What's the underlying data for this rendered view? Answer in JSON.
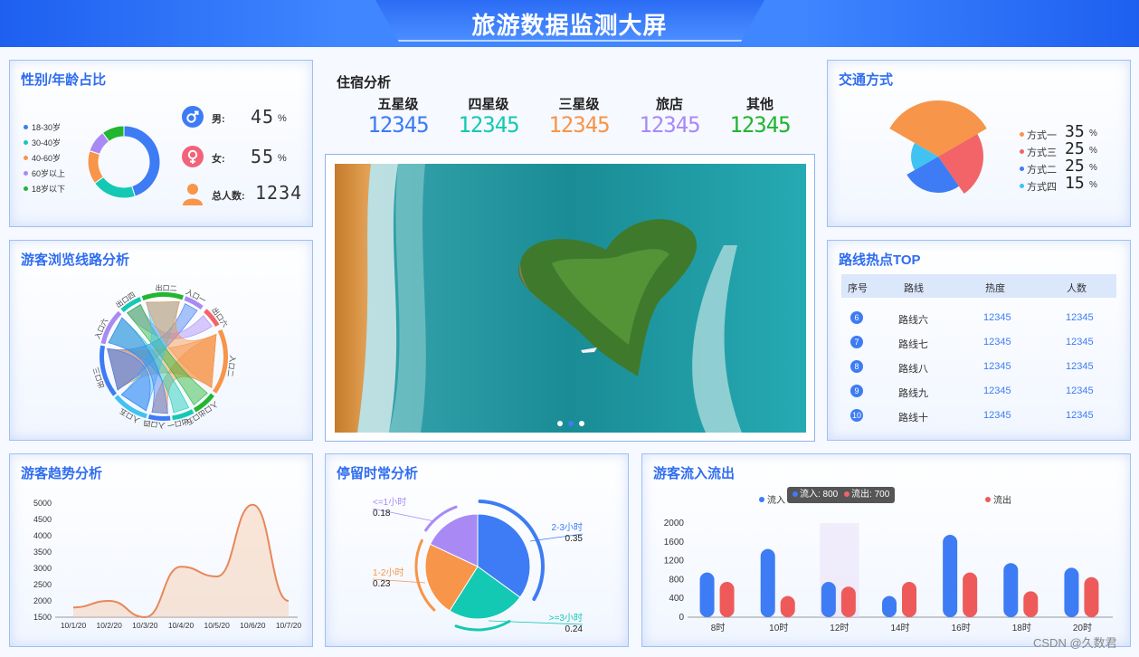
{
  "header": {
    "title": "旅游数据监测大屏"
  },
  "colors": {
    "blue": "#3d7cf4",
    "teal": "#14c9b4",
    "orange": "#f7954a",
    "purple": "#a98af5",
    "green": "#22b531",
    "red": "#f26467",
    "pink": "#f2627a",
    "cyan": "#40c2f2"
  },
  "gender": {
    "title": "性别/年龄占比",
    "legend": [
      "18-30岁",
      "30-40岁",
      "40-60岁",
      "60岁以上",
      "18岁以下"
    ],
    "male_label": "男:",
    "male_value": "45",
    "female_label": "女:",
    "female_value": "55",
    "percent": "%",
    "total_label": "总人数:",
    "total_value": "1234"
  },
  "lodging": {
    "title": "住宿分析",
    "items": [
      {
        "label": "五星级",
        "value": "12345"
      },
      {
        "label": "四星级",
        "value": "12345"
      },
      {
        "label": "三星级",
        "value": "12345"
      },
      {
        "label": "旅店",
        "value": "12345"
      },
      {
        "label": "其他",
        "value": "12345"
      }
    ]
  },
  "traffic": {
    "title": "交通方式",
    "items": [
      {
        "label": "方式一",
        "value": "35"
      },
      {
        "label": "方式三",
        "value": "25"
      },
      {
        "label": "方式二",
        "value": "25"
      },
      {
        "label": "方式四",
        "value": "15"
      }
    ],
    "percent": "%"
  },
  "route": {
    "title": "游客浏览线路分析",
    "nodes": [
      "入口一",
      "出口六",
      "入口二",
      "入口出口五",
      "出口一",
      "入口四",
      "入口五",
      "出口三",
      "入口六",
      "出口四",
      "出口二"
    ]
  },
  "hot": {
    "title": "路线热点TOP",
    "headers": [
      "序号",
      "路线",
      "热度",
      "人数"
    ],
    "rows": [
      {
        "no": "6",
        "route": "路线六",
        "heat": "12345",
        "people": "12345"
      },
      {
        "no": "7",
        "route": "路线七",
        "heat": "12345",
        "people": "12345"
      },
      {
        "no": "8",
        "route": "路线八",
        "heat": "12345",
        "people": "12345"
      },
      {
        "no": "9",
        "route": "路线九",
        "heat": "12345",
        "people": "12345"
      },
      {
        "no": "10",
        "route": "路线十",
        "heat": "12345",
        "people": "12345"
      }
    ]
  },
  "trend": {
    "title": "游客趋势分析"
  },
  "stay": {
    "title": "停留时常分析"
  },
  "flow": {
    "title": "游客流入流出",
    "legend_in": "流入",
    "legend_out": "流出",
    "tooltip_in": "流入: 800",
    "tooltip_out": "流出: 700"
  },
  "watermark": "CSDN @久数君",
  "chart_data": [
    {
      "type": "pie",
      "name": "gender_age",
      "categories": [
        "18-30岁",
        "30-40岁",
        "40-60岁",
        "60岁以上",
        "18岁以下"
      ],
      "values": [
        45,
        20,
        15,
        10,
        10
      ]
    },
    {
      "type": "pie",
      "name": "traffic",
      "categories": [
        "方式一",
        "方式三",
        "方式二",
        "方式四"
      ],
      "values": [
        35,
        25,
        25,
        15
      ]
    },
    {
      "type": "area",
      "name": "trend",
      "title": "",
      "x": [
        "10/1/20",
        "10/2/20",
        "10/3/20",
        "10/4/20",
        "10/5/20",
        "10/6/20",
        "10/7/20"
      ],
      "values": [
        1800,
        2000,
        1500,
        3050,
        2750,
        4950,
        2000
      ],
      "ylim": [
        1500,
        5000
      ],
      "yticks": [
        1500,
        2000,
        2500,
        3000,
        3500,
        4000,
        4500,
        5000
      ]
    },
    {
      "type": "pie",
      "name": "stay",
      "categories": [
        "2-3小时",
        "<=1小时",
        "1-2小时",
        ">=3小时"
      ],
      "values": [
        0.35,
        0.18,
        0.23,
        0.24
      ]
    },
    {
      "type": "bar",
      "name": "flow",
      "categories": [
        "8时",
        "10时",
        "12时",
        "14时",
        "16时",
        "18时",
        "20时"
      ],
      "series": [
        {
          "name": "流入",
          "values": [
            950,
            1450,
            750,
            450,
            1750,
            1150,
            1050
          ]
        },
        {
          "name": "流出",
          "values": [
            750,
            450,
            650,
            750,
            950,
            550,
            850
          ]
        }
      ],
      "ylim": [
        0,
        2000
      ],
      "yticks": [
        0,
        400,
        800,
        1200,
        1600,
        2000
      ]
    }
  ]
}
